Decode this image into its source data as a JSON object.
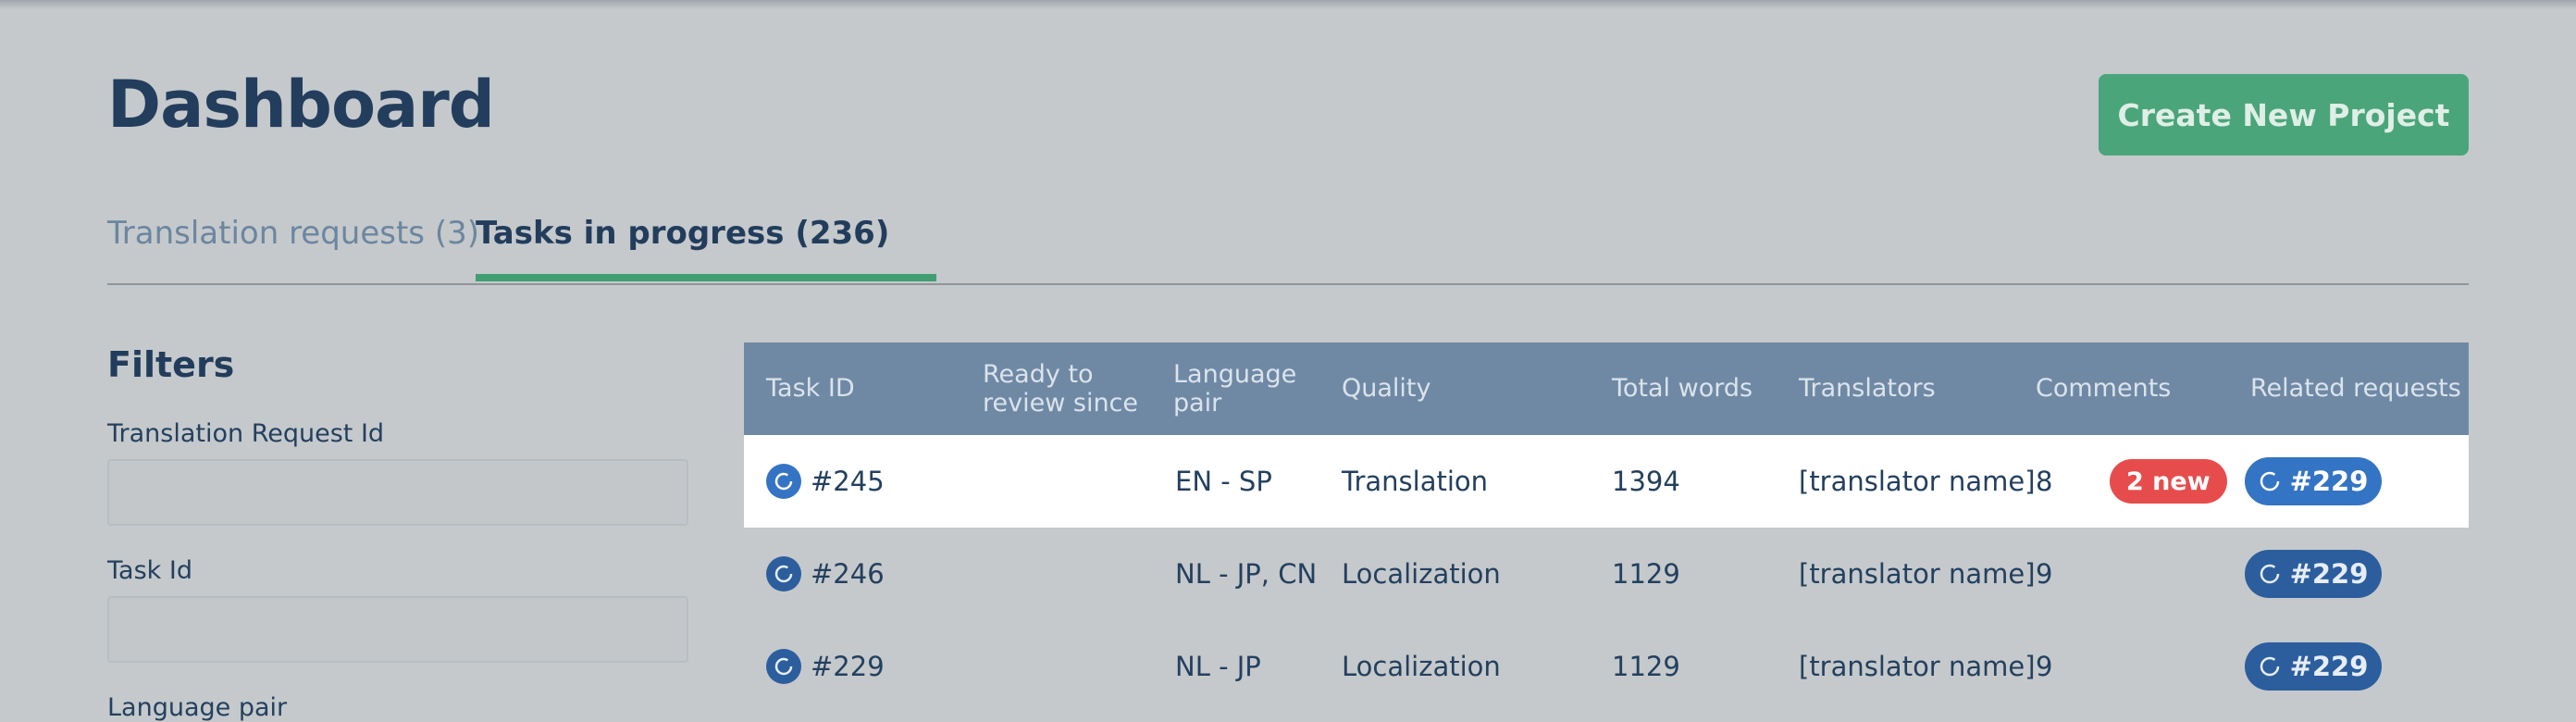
{
  "header": {
    "title": "Dashboard",
    "create_button_label": "Create New Project"
  },
  "tabs": [
    {
      "label": "Translation requests (3)",
      "active": false
    },
    {
      "label": "Tasks in progress (236)",
      "active": true
    }
  ],
  "filters": {
    "title": "Filters",
    "fields": [
      {
        "label": "Translation Request Id",
        "value": "",
        "placeholder": ""
      },
      {
        "label": "Task Id",
        "value": "",
        "placeholder": ""
      },
      {
        "label": "Language pair",
        "value": "",
        "placeholder": ""
      }
    ]
  },
  "table": {
    "columns": [
      "Task ID",
      "Ready to review since",
      "Language pair",
      "Quality",
      "Total words",
      "Translators",
      "Comments",
      "Related requests"
    ],
    "rows": [
      {
        "task_id": "#245",
        "ready_since": "",
        "language_pair": "EN - SP",
        "quality": "Translation",
        "total_words": "1394",
        "translators": "[translator name]",
        "comments": "8",
        "new_badge": "2 new",
        "related": "#229",
        "highlight": true
      },
      {
        "task_id": "#246",
        "ready_since": "",
        "language_pair": "NL - JP, CN",
        "quality": "Localization",
        "total_words": "1129",
        "translators": "[translator name]",
        "comments": "9",
        "new_badge": "",
        "related": "#229",
        "highlight": false
      },
      {
        "task_id": "#229",
        "ready_since": "",
        "language_pair": "NL - JP",
        "quality": "Localization",
        "total_words": "1129",
        "translators": "[translator name]",
        "comments": "9",
        "new_badge": "",
        "related": "#229",
        "highlight": false
      }
    ]
  },
  "colors": {
    "background": "#c5c9cb",
    "primary_green": "#4aa57a",
    "table_header": "#6f89a5",
    "badge_red": "#e74c4c",
    "pill_blue": "#3474c4"
  },
  "icons": {
    "task_status": "progress-circle-icon",
    "related_request": "progress-circle-icon"
  }
}
